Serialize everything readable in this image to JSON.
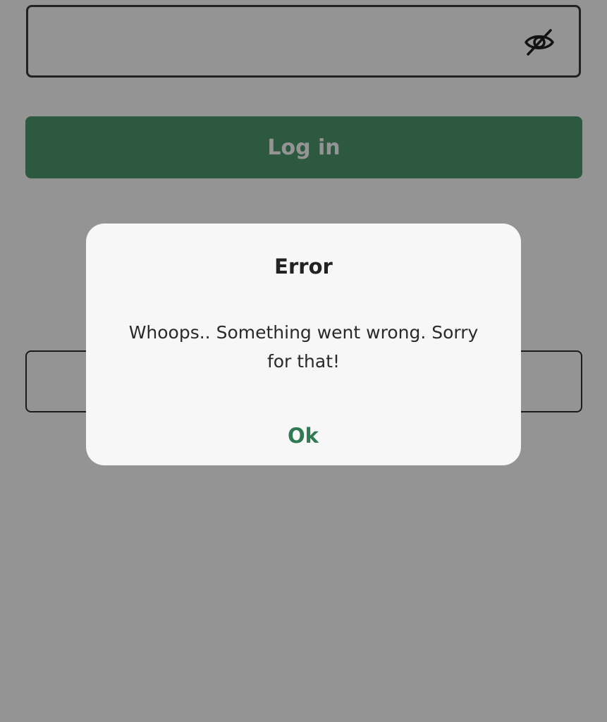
{
  "login_form": {
    "password_value": "",
    "password_toggle_icon": "eye-slash-icon",
    "login_label": "Log in"
  },
  "dialog": {
    "title": "Error",
    "message": "Whoops.. Something went wrong. Sorry for that!",
    "ok_label": "Ok"
  },
  "colors": {
    "brand_green": "#4e9a70",
    "ok_text": "#2f7a52",
    "dialog_background": "#f7f7f7"
  }
}
